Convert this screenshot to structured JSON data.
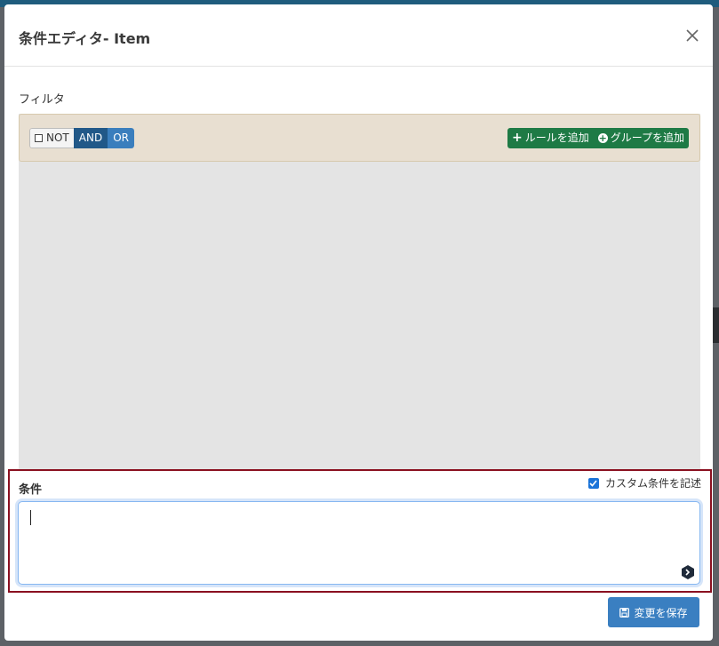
{
  "modal": {
    "title": "条件エディタ- Item"
  },
  "filter": {
    "label": "フィルタ",
    "not_label": "NOT",
    "and_label": "AND",
    "or_label": "OR",
    "add_rule_label": "ルールを追加",
    "add_group_label": "グループを追加"
  },
  "condition": {
    "label": "条件",
    "custom_checkbox_label": "カスタム条件を記述",
    "custom_checked": true,
    "value": ""
  },
  "footer": {
    "save_label": "変更を保存"
  },
  "colors": {
    "and_active": "#215888",
    "or": "#3a7ebd",
    "add_buttons": "#1e7a45",
    "group_header": "#e8dfd1",
    "highlight_border": "#8a1020",
    "save_button": "#3a7fc1"
  },
  "icons": {
    "close": "close-icon",
    "checkbox_not": "checkbox-icon",
    "add_rule": "plus-icon",
    "add_group": "plus-circle-icon",
    "checked": "check-icon",
    "extension": "extension-icon",
    "save": "save-disk-icon"
  }
}
